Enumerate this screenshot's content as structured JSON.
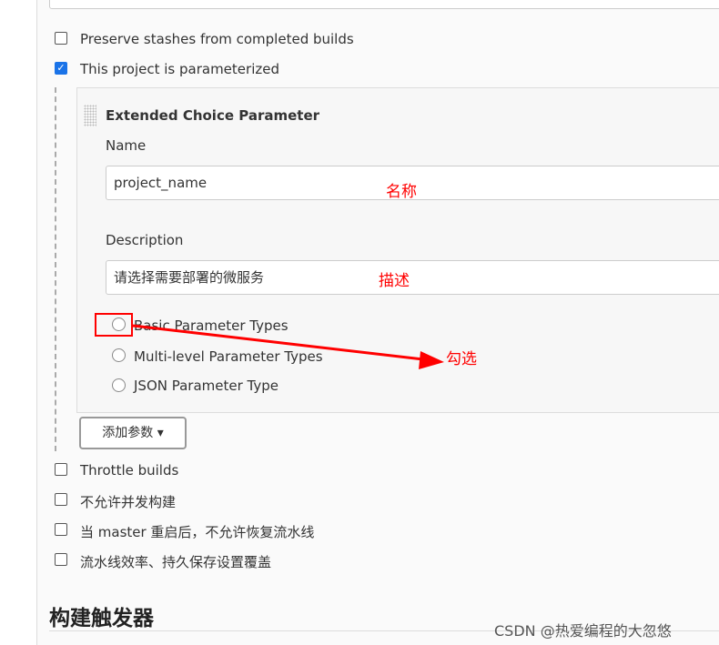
{
  "options": {
    "preserve_stashes": {
      "label": "Preserve stashes from completed builds",
      "checked": false
    },
    "parameterized": {
      "label": "This project is parameterized",
      "checked": true
    },
    "throttle": {
      "label": "Throttle builds",
      "checked": false
    },
    "no_concurrent": {
      "label": "不允许并发构建",
      "checked": false
    },
    "no_resume": {
      "label": "当 master 重启后，不允许恢复流水线",
      "checked": false
    },
    "durability": {
      "label": "流水线效率、持久保存设置覆盖",
      "checked": false
    }
  },
  "param": {
    "title": "Extended Choice Parameter",
    "name_label": "Name",
    "name_value": "project_name",
    "desc_label": "Description",
    "desc_value": "请选择需要部署的微服务",
    "radios": [
      "Basic Parameter Types",
      "Multi-level Parameter Types",
      "JSON Parameter Type"
    ]
  },
  "add_button": "添加参数",
  "section_title": "构建触发器",
  "annotations": {
    "name": "名称",
    "desc": "描述",
    "select": "勾选",
    "color": "#ff0000"
  },
  "watermark": "CSDN @热爱编程的大忽悠"
}
